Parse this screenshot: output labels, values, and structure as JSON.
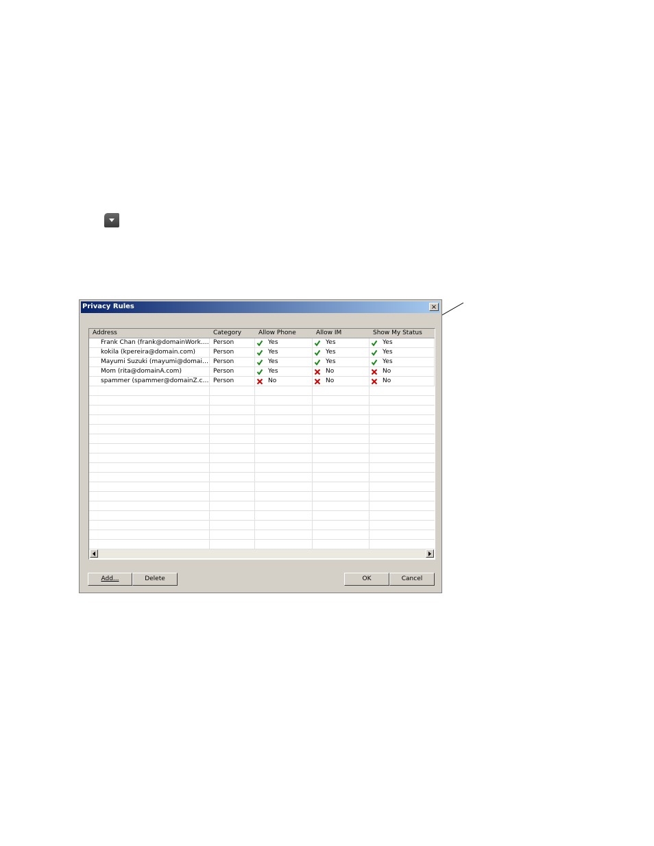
{
  "dialog": {
    "title": "Privacy Rules",
    "close_label": "×"
  },
  "columns": [
    "Address",
    "Category",
    "Allow Phone",
    "Allow IM",
    "Show My Status"
  ],
  "rows": [
    {
      "address": "Frank Chan (frank@domainWork.c...",
      "category": "Person",
      "phone": "Yes",
      "im": "Yes",
      "status": "Yes"
    },
    {
      "address": "kokila (kpereira@domain.com)",
      "category": "Person",
      "phone": "Yes",
      "im": "Yes",
      "status": "Yes"
    },
    {
      "address": "Mayumi Suzuki (mayumi@domain...",
      "category": "Person",
      "phone": "Yes",
      "im": "Yes",
      "status": "Yes"
    },
    {
      "address": "Mom (rita@domainA.com)",
      "category": "Person",
      "phone": "Yes",
      "im": "No",
      "status": "No"
    },
    {
      "address": "spammer (spammer@domainZ.com)",
      "category": "Person",
      "phone": "No",
      "im": "No",
      "status": "No"
    }
  ],
  "icons": {
    "yes": "green-check-icon",
    "no": "red-x-icon"
  },
  "colors": {
    "check": "#1a8a1a",
    "cross": "#d40000",
    "title_start": "#0a246a",
    "title_end": "#a6caf0"
  },
  "buttons": {
    "add": "Add...",
    "delete": "Delete",
    "ok": "OK",
    "cancel": "Cancel"
  }
}
